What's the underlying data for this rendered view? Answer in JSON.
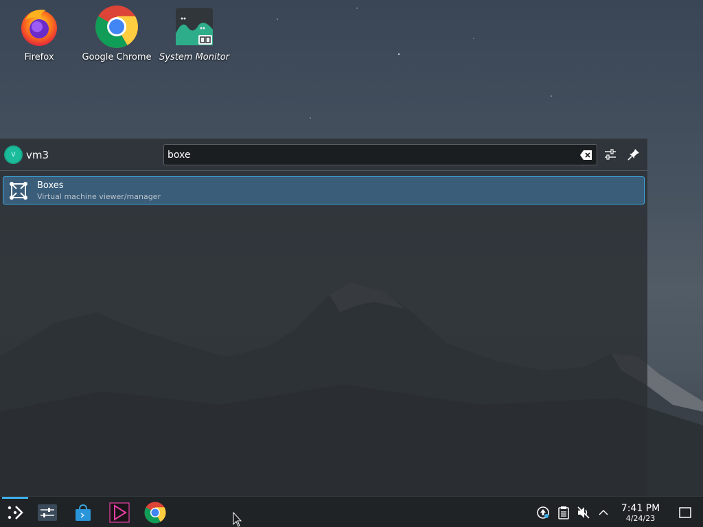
{
  "desktop": {
    "icons": [
      {
        "label": "Firefox",
        "icon": "firefox-icon"
      },
      {
        "label": "Google Chrome",
        "icon": "chrome-icon"
      },
      {
        "label": "System Monitor",
        "icon": "system-monitor-icon"
      }
    ]
  },
  "launcher": {
    "user": {
      "initial": "V",
      "name": "vm3"
    },
    "search": {
      "value": "boxe"
    },
    "buttons": [
      "settings-icon",
      "pin-icon"
    ],
    "results": [
      {
        "title": "Boxes",
        "subtitle": "Virtual machine viewer/manager",
        "icon": "boxes-icon"
      }
    ]
  },
  "taskbar": {
    "items": [
      "app-launcher-icon",
      "system-settings-icon",
      "discover-store-icon",
      "media-player-icon",
      "chrome-icon"
    ],
    "tray": [
      "update-icon",
      "clipboard-icon",
      "volume-muted-icon",
      "chevron-up-icon"
    ],
    "clock": {
      "time": "7:41 PM",
      "date": "4/24/23"
    },
    "show_desktop": "show-desktop-icon"
  },
  "colors": {
    "accent": "#3daee9",
    "panel_bg": "#2a2e32",
    "result_selected": "#3a5d7a",
    "taskbar_bg": "#202326"
  }
}
